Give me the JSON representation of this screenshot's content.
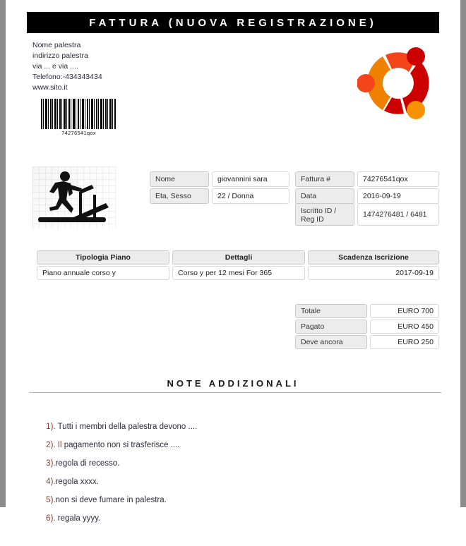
{
  "document": {
    "title": "FATTURA (NUOVA REGISTRAZIONE)"
  },
  "gym": {
    "name": "Nome palestra",
    "address_line1": "indirizzo palestra",
    "address_line2": "via ... e via ....",
    "phone": "Telefono:-434343434",
    "website": "www.sito.it"
  },
  "barcode": {
    "value": "74276541qox"
  },
  "details": {
    "member": [
      {
        "label": "Nome",
        "value": "giovannini sara"
      },
      {
        "label": "Eta, Sesso",
        "value": "22 / Donna"
      }
    ],
    "invoice": [
      {
        "label": "Fattura #",
        "value": "74276541qox"
      },
      {
        "label": "Data",
        "value": "2016-09-19"
      },
      {
        "label": "Iscritto ID / Reg ID",
        "value": "1474276481 / 6481"
      }
    ]
  },
  "plan_table": {
    "headers": [
      "Tipologia Piano",
      "Dettagli",
      "Scadenza Iscrizione"
    ],
    "rows": [
      [
        "Piano annuale corso y",
        "Corso y per 12 mesi For 365",
        "2017-09-19"
      ]
    ]
  },
  "totals": [
    {
      "label": "Totale",
      "value": "EURO 700"
    },
    {
      "label": "Pagato",
      "value": "EURO 450"
    },
    {
      "label": "Deve ancora",
      "value": "EURO 250"
    }
  ],
  "notes": {
    "heading": "NOTE ADDIZIONALI",
    "items": [
      {
        "number": "1).",
        "accent": "",
        "text": " Tutti i membri della palestra devono ...."
      },
      {
        "number": "2).",
        "accent": " Il",
        "text": " pagamento non si trasferisce ...."
      },
      {
        "number": "3).",
        "accent": "",
        "text": "regola di recesso."
      },
      {
        "number": "4).",
        "accent": "",
        "text": "regola xxxx."
      },
      {
        "number": "5).",
        "accent": "",
        "text": "non si deve fumare in palestra."
      },
      {
        "number": "6).",
        "accent": "",
        "text": " regala yyyy."
      }
    ]
  },
  "colors": {
    "title_bar_bg": "#000000",
    "label_cell_bg": "#ececec",
    "edge_bar": "#8c8c8c",
    "note_accent": "#8a3b2e",
    "logo_orange": "#f08000",
    "logo_orange_red": "#f4451a",
    "logo_dark_red": "#cc0000"
  },
  "icons": {
    "logo": "ubuntu-logo",
    "fitness": "treadmill-runner-icon",
    "barcode": "barcode-icon"
  }
}
